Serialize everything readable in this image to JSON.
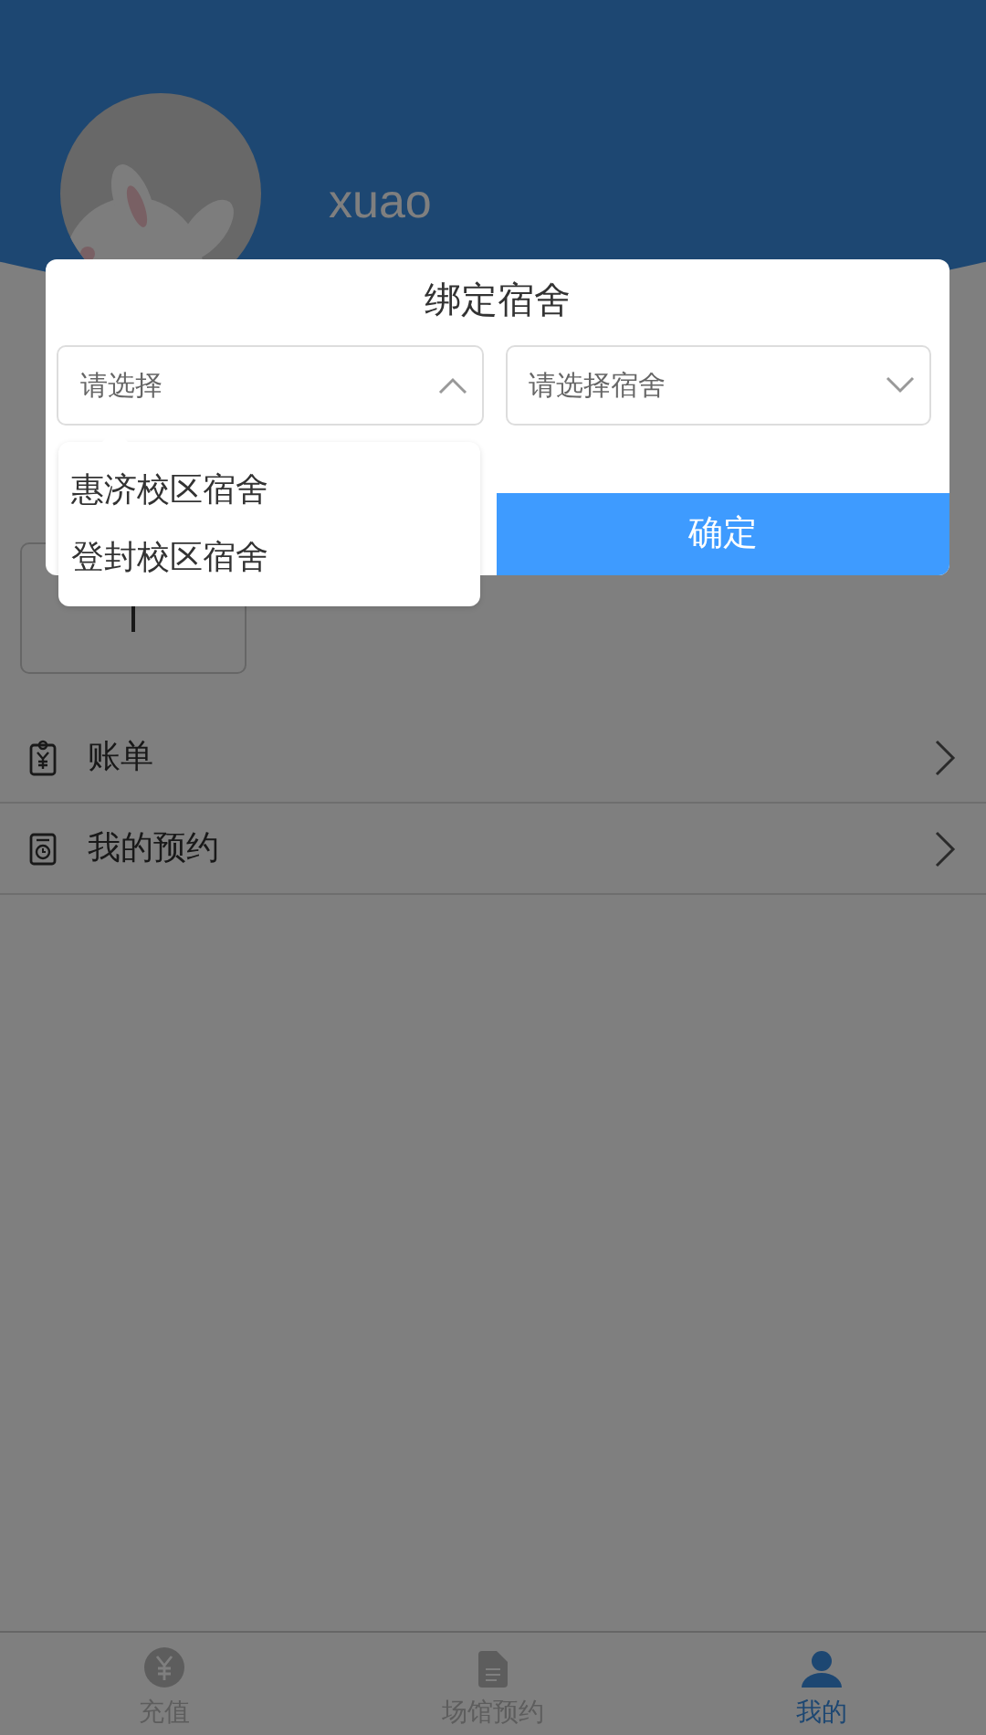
{
  "profile": {
    "username": "xuao"
  },
  "menu": [
    {
      "label": "账单",
      "kind": "bill"
    },
    {
      "label": "我的预约",
      "kind": "booking"
    }
  ],
  "tab_bar": [
    {
      "label": "充值",
      "kind": "yuan",
      "selected": false
    },
    {
      "label": "场馆预约",
      "kind": "document",
      "selected": false
    },
    {
      "label": "我的",
      "kind": "person",
      "selected": true
    }
  ],
  "dialog": {
    "title": "绑定宿舍",
    "selects": [
      {
        "placeholder": "请选择",
        "expanded": true,
        "options": [
          "惠济校区宿舍",
          "登封校区宿舍"
        ]
      },
      {
        "placeholder": "请选择宿舍",
        "expanded": false
      }
    ],
    "confirm": "确定"
  }
}
